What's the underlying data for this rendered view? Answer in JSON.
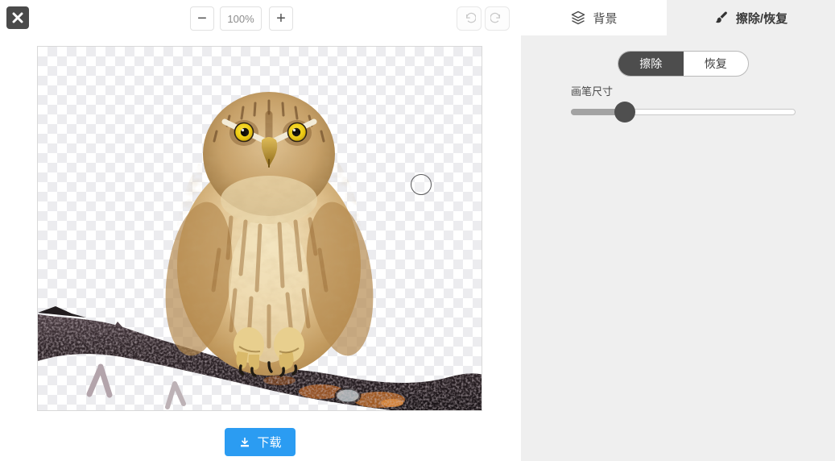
{
  "toolbar": {
    "zoom_out": "−",
    "zoom_value": "100%",
    "zoom_in": "+"
  },
  "tabs": {
    "background": {
      "label": "背景",
      "active": false
    },
    "erase_restore": {
      "label": "擦除/恢复",
      "active": true
    }
  },
  "panel": {
    "modes": {
      "erase": {
        "label": "擦除",
        "active": true
      },
      "restore": {
        "label": "恢复",
        "active": false
      }
    },
    "brush_size_label": "画笔尺寸",
    "brush_position": "24%"
  },
  "footer": {
    "download_label": "下载"
  },
  "colors": {
    "accent_blue": "#2b9cf2",
    "panel_gray": "#efefef",
    "segment_dark": "#4d4d4d",
    "checker_gray": "#ececef"
  }
}
